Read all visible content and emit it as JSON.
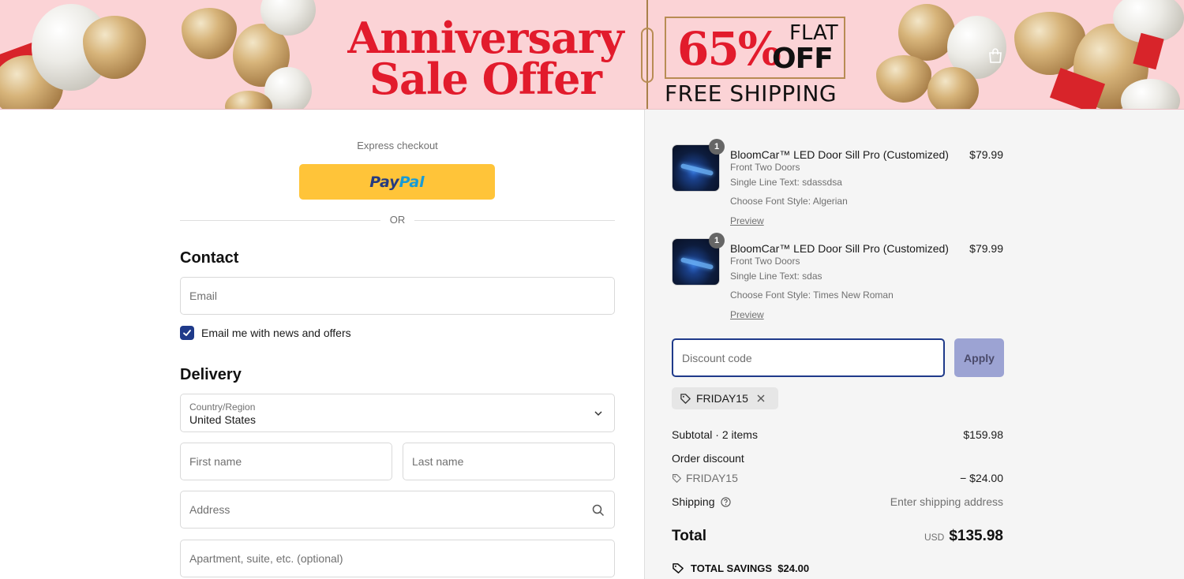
{
  "banner": {
    "title_line1": "Anniversary",
    "title_line2": "Sale Offer",
    "percent": "65%",
    "flat": "FLAT",
    "off": "OFF",
    "free_shipping": "FREE SHIPPING"
  },
  "express": {
    "label": "Express checkout",
    "paypal_part1": "Pay",
    "paypal_part2": "Pal",
    "or": "OR"
  },
  "contact": {
    "title": "Contact",
    "email_placeholder": "Email",
    "newsletter_label": "Email me with news and offers",
    "newsletter_checked": true
  },
  "delivery": {
    "title": "Delivery",
    "country_label": "Country/Region",
    "country_value": "United States",
    "first_name_placeholder": "First name",
    "last_name_placeholder": "Last name",
    "address_placeholder": "Address",
    "apartment_placeholder": "Apartment, suite, etc. (optional)"
  },
  "cart": {
    "items": [
      {
        "qty": "1",
        "title": "BloomCar™ LED Door Sill Pro (Customized)",
        "price": "$79.99",
        "variant": "Front Two Doors",
        "line_text": "Single Line Text: sdassdsa",
        "font_style": "Choose Font Style: Algerian",
        "preview": "Preview"
      },
      {
        "qty": "1",
        "title": "BloomCar™ LED Door Sill Pro (Customized)",
        "price": "$79.99",
        "variant": "Front Two Doors",
        "line_text": "Single Line Text: sdas",
        "font_style": "Choose Font Style: Times New Roman",
        "preview": "Preview"
      }
    ]
  },
  "discount": {
    "placeholder": "Discount code",
    "apply": "Apply",
    "applied_code": "FRIDAY15"
  },
  "summary": {
    "subtotal_label": "Subtotal · 2 items",
    "subtotal_value": "$159.98",
    "order_discount_label": "Order discount",
    "discount_code": "FRIDAY15",
    "discount_value": "− $24.00",
    "shipping_label": "Shipping",
    "shipping_value": "Enter shipping address",
    "total_label": "Total",
    "total_currency": "USD",
    "total_value": "$135.98",
    "savings_label": "TOTAL SAVINGS",
    "savings_value": "$24.00"
  },
  "colors": {
    "accent": "#1f3a8a",
    "banner_bg": "#fbd3d6",
    "sale_red": "#e21b2c",
    "paypal_yellow": "#ffc439"
  }
}
